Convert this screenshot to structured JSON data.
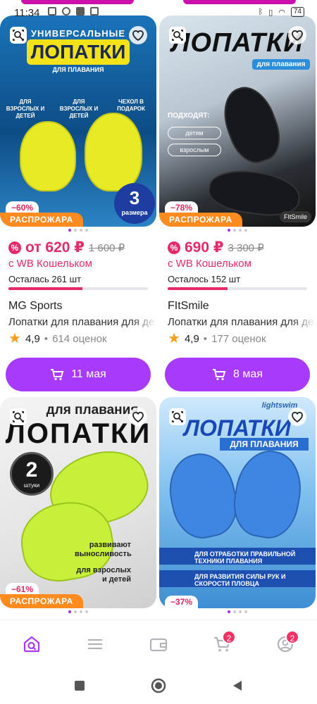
{
  "status_bar": {
    "time": "11:34",
    "battery": "74"
  },
  "products": [
    {
      "image": {
        "subtitle": "УНИВЕРСАЛЬНЫЕ",
        "title": "ЛОПАТКИ",
        "tagline": "ДЛЯ ПЛАВАНИЯ",
        "features": [
          "ДЛЯ ВЗРОСЛЫХ И ДЕТЕЙ",
          "ДЛЯ ВЗРОСЛЫХ И ДЕТЕЙ",
          "ЧЕХОЛ В ПОДАРОК"
        ],
        "count_number": "3",
        "count_word": "размера"
      },
      "discount": "−60%",
      "sale_label": "РАСПРОЖАРА",
      "price": "от 620 ₽",
      "old_price": "1 600 ₽",
      "wallet_note": "с WB Кошельком",
      "stock": "Осталась 261 шт",
      "stock_fraction": 0.53,
      "brand": "MG Sports",
      "name": "Лопатки для плавания для детей",
      "rating": "4,9",
      "reviews": "614 оценок",
      "delivery": "11 мая"
    },
    {
      "image": {
        "title": "ЛОПАТКИ",
        "tagline": "для плавания",
        "suits_label": "ПОДХОДЯТ:",
        "chips": [
          "детям",
          "взрослым"
        ],
        "brand_mark": "FItSmile"
      },
      "discount": "−78%",
      "sale_label": "РАСПРОЖАРА",
      "price": "690 ₽",
      "old_price": "3 300 ₽",
      "wallet_note": "с WB Кошельком",
      "stock": "Осталось 152 шт",
      "stock_fraction": 0.43,
      "brand": "FItSmile",
      "name": "Лопатки для плавания для детей",
      "rating": "4,9",
      "reviews": "177 оценок",
      "delivery": "8 мая"
    },
    {
      "image": {
        "subtitle": "для плавания",
        "title": "ЛОПАТКИ",
        "count_number": "2",
        "count_word": "штуки",
        "feature1": "развивают выносливость",
        "feature2": "для взрослых и детей"
      },
      "discount": "−61%",
      "sale_label": "РАСПРОЖАРА"
    },
    {
      "image": {
        "brand_mark": "lightswim",
        "title": "ЛОПАТКИ",
        "tagline": "ДЛЯ ПЛАВАНИЯ",
        "feature1": "ДЛЯ ОТРАБОТКИ ПРАВИЛЬНОЙ ТЕХНИКИ ПЛАВАНИЯ",
        "feature2": "ДЛЯ РАЗВИТИЯ СИЛЫ РУК И СКОРОСТИ ПЛОВЦА"
      },
      "discount": "−37%"
    }
  ],
  "bottom_nav": {
    "items": [
      "home",
      "catalog",
      "wallet",
      "cart",
      "profile"
    ],
    "cart_badge": "2",
    "profile_badge": "2"
  },
  "colors": {
    "accent": "#a73afd",
    "price": "#e52a6a",
    "sale": "#ff8a1d"
  }
}
